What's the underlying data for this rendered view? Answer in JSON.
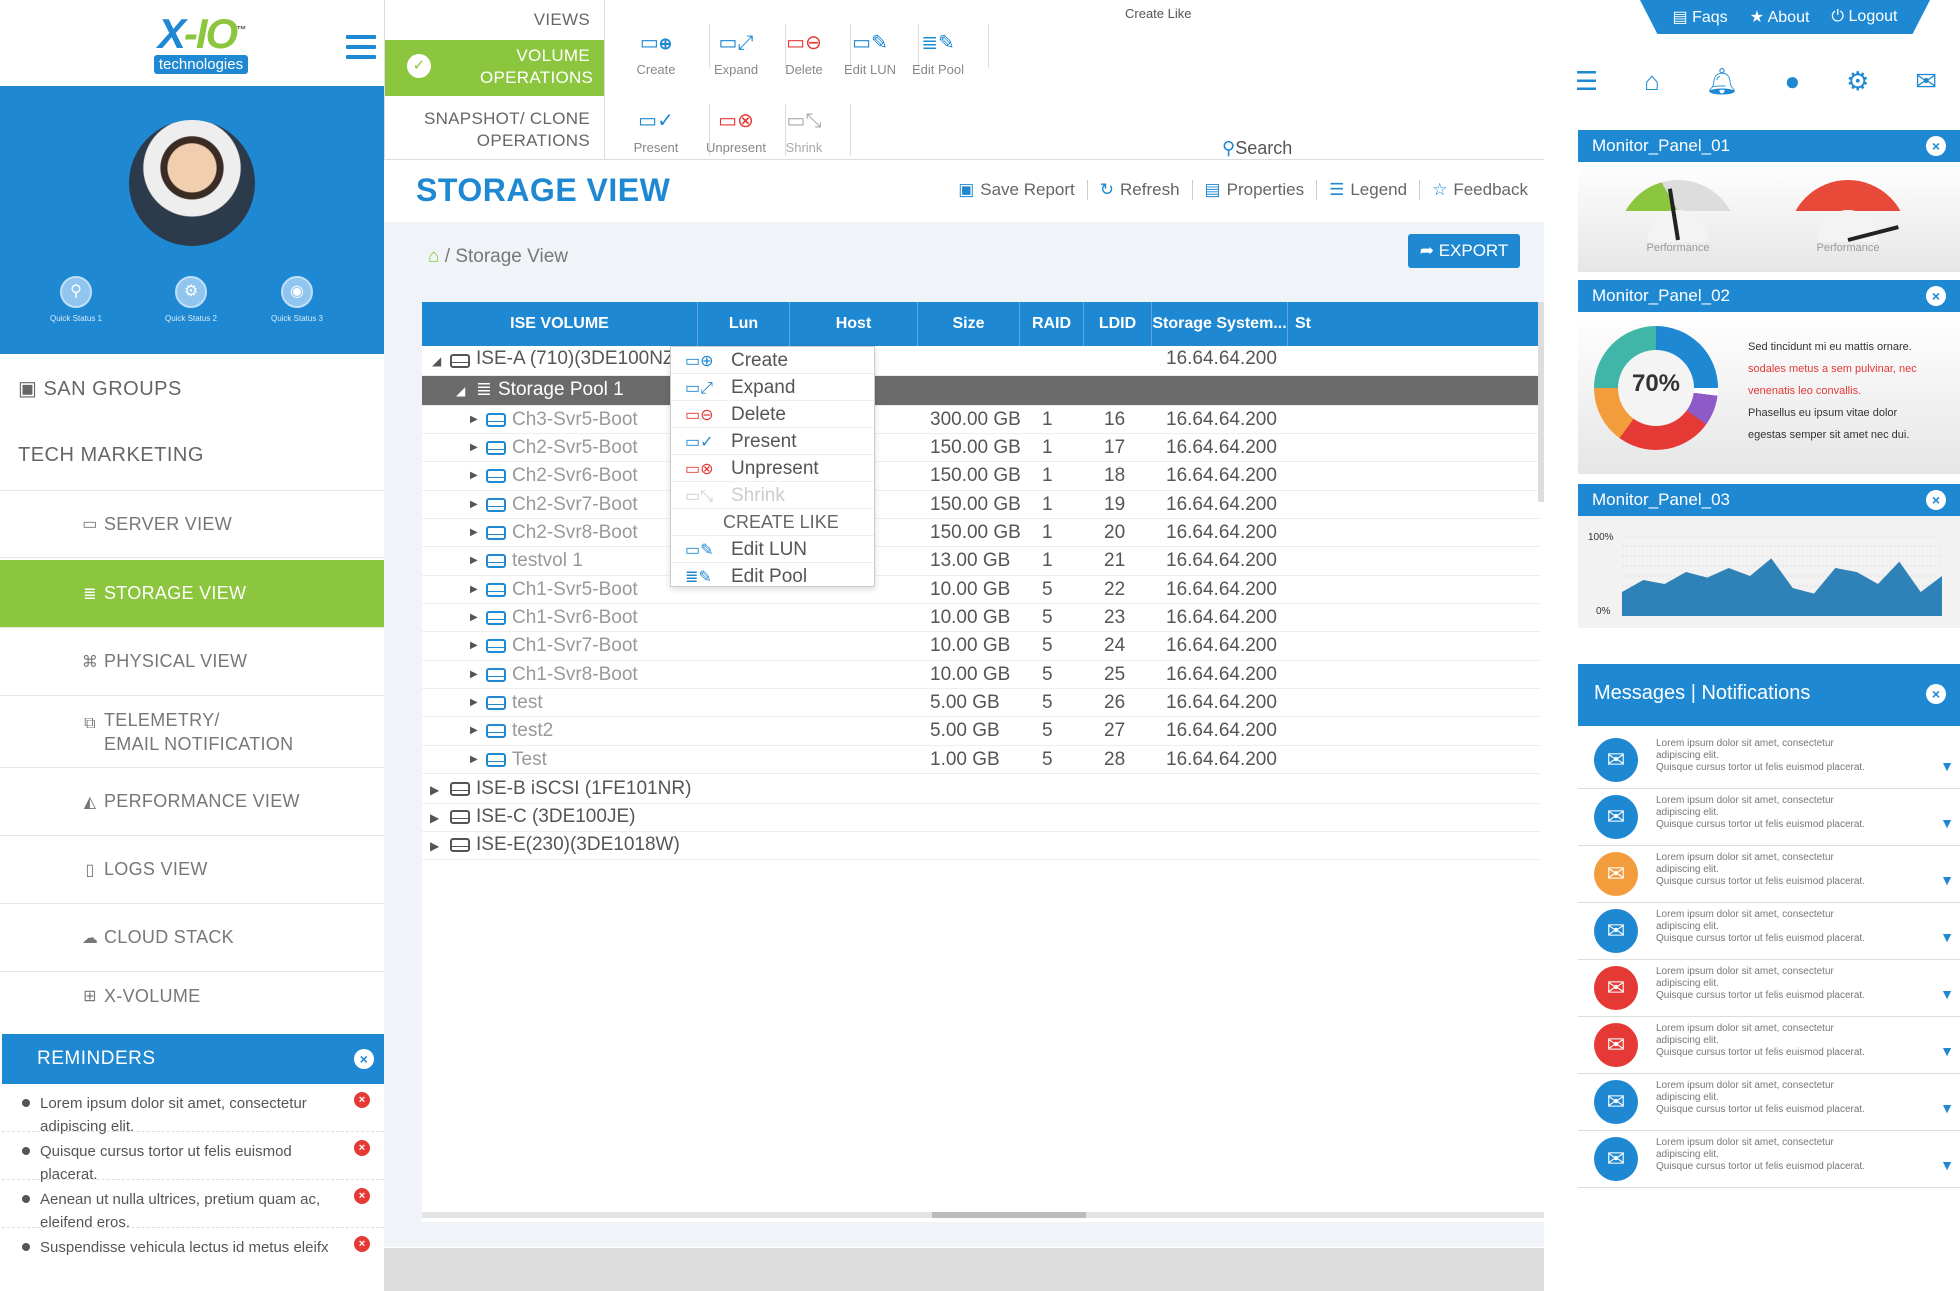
{
  "brand": {
    "logo_x": "X",
    "logo_io": "IO",
    "logo_tm": "™",
    "logo_sub": "technologies"
  },
  "quick_status": [
    "Quick Status 1",
    "Quick Status 2",
    "Quick Status 3"
  ],
  "nav": {
    "san_groups": "SAN GROUPS",
    "tech_marketing": "TECH MARKETING",
    "items": [
      {
        "label": "SERVER VIEW",
        "icon": "server-icon"
      },
      {
        "label": "STORAGE VIEW",
        "icon": "database-icon",
        "active": true
      },
      {
        "label": "PHYSICAL VIEW",
        "icon": "binoculars-icon"
      },
      {
        "label": "TELEMETRY/",
        "label2": "EMAIL NOTIFICATION",
        "icon": "copy-icon"
      },
      {
        "label": "PERFORMANCE VIEW",
        "icon": "area-chart-icon"
      },
      {
        "label": "LOGS VIEW",
        "icon": "file-icon"
      },
      {
        "label": "CLOUD STACK",
        "icon": "cloud-icon"
      },
      {
        "label": "X-VOLUME",
        "icon": "sitemap-icon"
      }
    ]
  },
  "reminders": {
    "title": "REMINDERS",
    "items": [
      "Lorem ipsum dolor sit amet, consectetur adipiscing elit.",
      "Quisque cursus tortor ut felis euismod placerat.",
      "Aenean ut nulla ultrices, pretium quam ac, eleifend eros.",
      "Suspendisse vehicula lectus id metus eleifx"
    ]
  },
  "views": {
    "label": "VIEWS",
    "volume_ops": "VOLUME OPERATIONS",
    "snapshot_ops": "SNAPSHOT/ CLONE OPERATIONS"
  },
  "toolbar": {
    "create_like": "Create Like",
    "create": "Create",
    "expand": "Expand",
    "delete": "Delete",
    "edit_lun": "Edit LUN",
    "edit_pool": "Edit Pool",
    "present": "Present",
    "unpresent": "Unpresent",
    "shrink": "Shrink",
    "search": "Search"
  },
  "page": {
    "title": "STORAGE VIEW",
    "save_report": "Save Report",
    "refresh": "Refresh",
    "properties": "Properties",
    "legend": "Legend",
    "feedback": "Feedback",
    "breadcrumb": "/ Storage View",
    "export": "EXPORT"
  },
  "columns": [
    "ISE VOLUME",
    "Lun",
    "Host",
    "Size",
    "RAID",
    "LDID",
    "Storage System...",
    "St"
  ],
  "tree": {
    "ise_a": "ISE-A (710)(3DE100NZ)",
    "ise_a_ip": "16.64.64.200",
    "pool": "Storage Pool 1",
    "volumes": [
      [
        "Ch3-Svr5-Boot",
        "300.00 GB",
        "1",
        "16",
        "16.64.64.200"
      ],
      [
        "Ch2-Svr5-Boot",
        "150.00 GB",
        "1",
        "17",
        "16.64.64.200"
      ],
      [
        "Ch2-Svr6-Boot",
        "150.00 GB",
        "1",
        "18",
        "16.64.64.200"
      ],
      [
        "Ch2-Svr7-Boot",
        "150.00 GB",
        "1",
        "19",
        "16.64.64.200"
      ],
      [
        "Ch2-Svr8-Boot",
        "150.00 GB",
        "1",
        "20",
        "16.64.64.200"
      ],
      [
        "testvol 1",
        "13.00 GB",
        "1",
        "21",
        "16.64.64.200"
      ],
      [
        "Ch1-Svr5-Boot",
        "10.00 GB",
        "5",
        "22",
        "16.64.64.200"
      ],
      [
        "Ch1-Svr6-Boot",
        "10.00 GB",
        "5",
        "23",
        "16.64.64.200"
      ],
      [
        "Ch1-Svr7-Boot",
        "10.00 GB",
        "5",
        "24",
        "16.64.64.200"
      ],
      [
        "Ch1-Svr8-Boot",
        "10.00 GB",
        "5",
        "25",
        "16.64.64.200"
      ],
      [
        "test",
        "5.00 GB",
        "5",
        "26",
        "16.64.64.200"
      ],
      [
        "test2",
        "5.00 GB",
        "5",
        "27",
        "16.64.64.200"
      ],
      [
        "Test",
        "1.00 GB",
        "5",
        "28",
        "16.64.64.200"
      ]
    ],
    "others": [
      "ISE-B iSCSI (1FE101NR)",
      "ISE-C (3DE100JE)",
      "ISE-E(230)(3DE1018W)"
    ]
  },
  "context_menu": {
    "create": "Create",
    "expand": "Expand",
    "delete": "Delete",
    "present": "Present",
    "unpresent": "Unpresent",
    "shrink": "Shrink",
    "create_like": "CREATE LIKE",
    "edit_lun": "Edit LUN",
    "edit_pool": "Edit Pool"
  },
  "top_links": {
    "faqs": "Faqs",
    "about": "About",
    "logout": "Logout"
  },
  "panels": {
    "p1": "Monitor_Panel_01",
    "p2": "Monitor_Panel_02",
    "p3": "Monitor_Panel_03",
    "perf": "Performance",
    "gauge1_value": 0.45,
    "gauge2_value": 0.92,
    "donut_value": "70%",
    "donut_text": [
      "Sed tincidunt mi eu mattis ornare.",
      "sodales metus a sem pulvinar, nec",
      "venenatis leo convallis.",
      "Phasellus eu ipsum vitae dolor",
      "egestas semper sit amet nec dui."
    ],
    "y_hi": "100%",
    "y_lo": "0%",
    "area_values": [
      30,
      45,
      40,
      55,
      48,
      60,
      50,
      72,
      35,
      28,
      60,
      55,
      40,
      68,
      30,
      50
    ]
  },
  "messages": {
    "title": "Messages",
    "sep": "|",
    "notif": "Notifications",
    "line1": "Lorem ipsum dolor sit amet, consectetur",
    "line2": "adipiscing elit.",
    "line3": "Quisque cursus tortor ut felis euismod placerat.",
    "colors": [
      "#1e88d2",
      "#1e88d2",
      "#f39c3c",
      "#1e88d2",
      "#e53935",
      "#e53935",
      "#1e88d2",
      "#1e88d2"
    ]
  },
  "colors": {
    "accent": "#1e88d2",
    "active": "#8cc63f",
    "danger": "#e53935"
  }
}
